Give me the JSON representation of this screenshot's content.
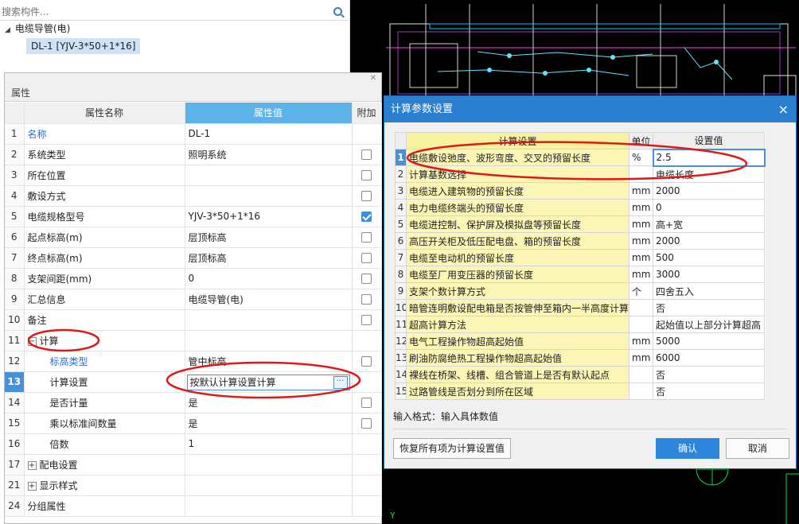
{
  "tree": {
    "search_placeholder": "搜索构件...",
    "root_label": "电缆导管(电)",
    "child_label": "DL-1 [YJV-3*50+1*16]"
  },
  "props": {
    "title": "属性",
    "header": {
      "name": "属性名称",
      "value": "属性值",
      "extra": "附加"
    },
    "rows": [
      {
        "num": "1",
        "name": "名称",
        "value": "DL-1",
        "checkbox": "none"
      },
      {
        "num": "2",
        "name": "系统类型",
        "value": "照明系统",
        "checkbox": "empty"
      },
      {
        "num": "3",
        "name": "所在位置",
        "value": "",
        "checkbox": "empty"
      },
      {
        "num": "4",
        "name": "敷设方式",
        "value": "",
        "checkbox": "empty"
      },
      {
        "num": "5",
        "name": "电缆规格型号",
        "value": "YJV-3*50+1*16",
        "checkbox": "checked"
      },
      {
        "num": "6",
        "name": "起点标高(m)",
        "value": "层顶标高",
        "checkbox": "empty"
      },
      {
        "num": "7",
        "name": "终点标高(m)",
        "value": "层顶标高",
        "checkbox": "empty"
      },
      {
        "num": "8",
        "name": "支架间距(mm)",
        "value": "0",
        "checkbox": "empty"
      },
      {
        "num": "9",
        "name": "汇总信息",
        "value": "电缆导管(电)",
        "checkbox": "empty"
      },
      {
        "num": "10",
        "name": "备注",
        "value": "",
        "checkbox": "empty"
      },
      {
        "num": "11",
        "name": "计算",
        "value": "",
        "checkbox": "none"
      },
      {
        "num": "12",
        "name": "标高类型",
        "value": "管中标高",
        "checkbox": "empty"
      },
      {
        "num": "13",
        "name": "计算设置",
        "value": "按默认计算设置计算",
        "checkbox": "none"
      },
      {
        "num": "14",
        "name": "是否计量",
        "value": "是",
        "checkbox": "empty"
      },
      {
        "num": "15",
        "name": "乘以标准间数量",
        "value": "是",
        "checkbox": "empty"
      },
      {
        "num": "16",
        "name": "倍数",
        "value": "1",
        "checkbox": "none"
      },
      {
        "num": "17",
        "name": "配电设置",
        "value": "",
        "checkbox": "none"
      },
      {
        "num": "21",
        "name": "显示样式",
        "value": "",
        "checkbox": "none"
      },
      {
        "num": "24",
        "name": "分组属性",
        "value": "",
        "checkbox": "none"
      }
    ],
    "ellipsis_label": "···"
  },
  "dialog": {
    "title": "计算参数设置",
    "header": {
      "name": "计算设置",
      "unit": "单位",
      "value": "设置值"
    },
    "rows": [
      {
        "num": "1",
        "name": "电缆敷设弛度、波形弯度、交叉的预留长度",
        "unit": "%",
        "value": "2.5"
      },
      {
        "num": "2",
        "name": "计算基数选择",
        "unit": "",
        "value": "电缆长度"
      },
      {
        "num": "3",
        "name": "电缆进入建筑物的预留长度",
        "unit": "mm",
        "value": "2000"
      },
      {
        "num": "4",
        "name": "电力电缆终端头的预留长度",
        "unit": "mm",
        "value": "0"
      },
      {
        "num": "5",
        "name": "电缆进控制、保护屏及模拟盘等预留长度",
        "unit": "mm",
        "value": "高+宽"
      },
      {
        "num": "6",
        "name": "高压开关柜及低压配电盘、箱的预留长度",
        "unit": "mm",
        "value": "2000"
      },
      {
        "num": "7",
        "name": "电缆至电动机的预留长度",
        "unit": "mm",
        "value": "500"
      },
      {
        "num": "8",
        "name": "电缆至厂用变压器的预留长度",
        "unit": "mm",
        "value": "3000"
      },
      {
        "num": "9",
        "name": "支架个数计算方式",
        "unit": "个",
        "value": "四舍五入"
      },
      {
        "num": "10",
        "name": "暗管连明敷设配电箱是否按管伸至箱内一半高度计算",
        "unit": "",
        "value": "否"
      },
      {
        "num": "11",
        "name": "超高计算方法",
        "unit": "",
        "value": "起始值以上部分计算超高"
      },
      {
        "num": "12",
        "name": "电气工程操作物超高起始值",
        "unit": "mm",
        "value": "5000"
      },
      {
        "num": "13",
        "name": "刷油防腐绝热工程操作物超高起始值",
        "unit": "mm",
        "value": "6000"
      },
      {
        "num": "14",
        "name": "裸线在桥架、线槽、组合管道上是否有默认起点",
        "unit": "",
        "value": "否"
      },
      {
        "num": "15",
        "name": "过路管线是否划分到所在区域",
        "unit": "",
        "value": "否"
      }
    ],
    "input_format": "输入格式：输入具体数值",
    "restore_button": "恢复所有项为计算设置值",
    "ok_button": "确认",
    "cancel_button": "取消",
    "close_icon": "×"
  },
  "cad": {
    "axis_label": "Y"
  },
  "colors": {
    "accent_blue": "#2b7fd1",
    "header_value_blue": "#5cb3e9",
    "annotation_red": "#e01818",
    "cad_background": "#000000"
  }
}
